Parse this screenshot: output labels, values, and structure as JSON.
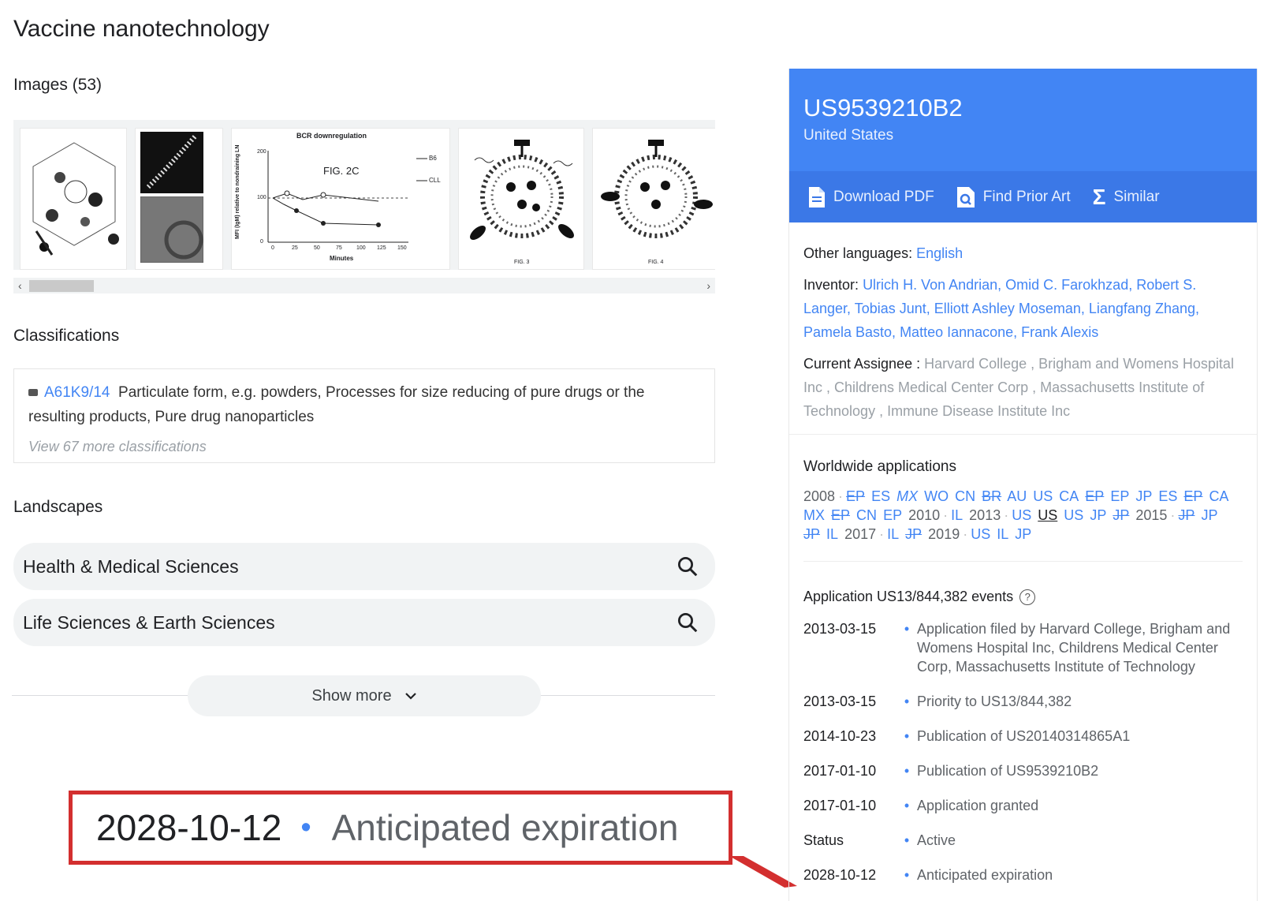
{
  "page": {
    "title": "Vaccine nanotechnology"
  },
  "images": {
    "heading": "Images (53)",
    "thumbs": [
      {
        "caption": "",
        "fig": ""
      },
      {
        "caption": "",
        "fig": ""
      },
      {
        "caption": "BCR downregulation",
        "fig": "FIG. 2C",
        "ylabel": "MFI (IgM) relative to nondraining LN",
        "xlabel": "Minutes",
        "legend": [
          "B6",
          "CLL"
        ],
        "xticks": [
          "0",
          "25",
          "50",
          "75",
          "100",
          "125",
          "150"
        ],
        "yticks": [
          "0",
          "100",
          "200"
        ]
      },
      {
        "caption": "",
        "fig": "FIG. 3"
      },
      {
        "caption": "",
        "fig": "FIG. 4"
      }
    ]
  },
  "classifications": {
    "heading": "Classifications",
    "code": "A61K9/14",
    "description": "Particulate form, e.g. powders, Processes for size reducing of pure drugs or the resulting products, Pure drug nanoparticles",
    "more": "View 67 more classifications"
  },
  "landscapes": {
    "heading": "Landscapes",
    "items": [
      "Health & Medical Sciences",
      "Life Sciences & Earth Sciences"
    ],
    "show_more": "Show more"
  },
  "callout": {
    "date": "2028-10-12",
    "label": "Anticipated expiration"
  },
  "patent": {
    "number": "US9539210B2",
    "country": "United States",
    "actions": {
      "download": "Download PDF",
      "prior_art": "Find Prior Art",
      "similar": "Similar"
    },
    "other_languages_label": "Other languages:",
    "other_languages_value": "English",
    "inventor_label": "Inventor:",
    "inventors": "Ulrich H. Von Andrian, Omid C. Farokhzad, Robert S. Langer, Tobias Junt, Elliott Ashley Moseman, Liangfang Zhang, Pamela Basto, Matteo Iannacone, Frank Alexis",
    "assignee_label": "Current Assignee :",
    "assignees": "Harvard College , Brigham and Womens Hospital Inc , Childrens Medical Center Corp , Massachusetts Institute of Technology , Immune Disease Institute Inc",
    "worldwide_title": "Worldwide applications",
    "worldwide": [
      {
        "year": "2008",
        "codes": [
          [
            "EP",
            "strike"
          ],
          [
            "ES",
            ""
          ],
          [
            "MX",
            "italic"
          ],
          [
            "WO",
            ""
          ],
          [
            "CN",
            ""
          ],
          [
            "BR",
            "strike"
          ],
          [
            "AU",
            ""
          ],
          [
            "US",
            ""
          ],
          [
            "CA",
            ""
          ],
          [
            "EP",
            "strike"
          ],
          [
            "EP",
            ""
          ],
          [
            "JP",
            ""
          ],
          [
            "ES",
            ""
          ],
          [
            "EP",
            "strike"
          ],
          [
            "CA",
            ""
          ],
          [
            "MX",
            ""
          ],
          [
            "EP",
            "strike"
          ],
          [
            "CN",
            ""
          ],
          [
            "EP",
            ""
          ]
        ]
      },
      {
        "year": "2010",
        "codes": [
          [
            "IL",
            ""
          ]
        ]
      },
      {
        "year": "2013",
        "codes": [
          [
            "US",
            ""
          ],
          [
            "US",
            "under"
          ],
          [
            "US",
            ""
          ],
          [
            "JP",
            ""
          ],
          [
            "JP",
            "strike"
          ]
        ]
      },
      {
        "year": "2015",
        "codes": [
          [
            "JP",
            "strike"
          ],
          [
            "JP",
            ""
          ],
          [
            "JP",
            "strike"
          ],
          [
            "IL",
            ""
          ]
        ]
      },
      {
        "year": "2017",
        "codes": [
          [
            "IL",
            ""
          ],
          [
            "JP",
            "strike"
          ]
        ]
      },
      {
        "year": "2019",
        "codes": [
          [
            "US",
            ""
          ],
          [
            "IL",
            ""
          ],
          [
            "JP",
            ""
          ]
        ]
      }
    ],
    "events_title": "Application US13/844,382 events",
    "events": [
      {
        "date": "2013-03-15",
        "desc": "Application filed by Harvard College, Brigham and Womens Hospital Inc, Childrens Medical Center Corp, Massachusetts Institute of Technology"
      },
      {
        "date": "2013-03-15",
        "desc": "Priority to US13/844,382"
      },
      {
        "date": "2014-10-23",
        "desc": "Publication of US20140314865A1"
      },
      {
        "date": "2017-01-10",
        "desc": "Publication of US9539210B2"
      },
      {
        "date": "2017-01-10",
        "desc": "Application granted"
      },
      {
        "date": "Status",
        "desc": "Active"
      },
      {
        "date": "2028-10-12",
        "desc": "Anticipated expiration"
      }
    ]
  }
}
